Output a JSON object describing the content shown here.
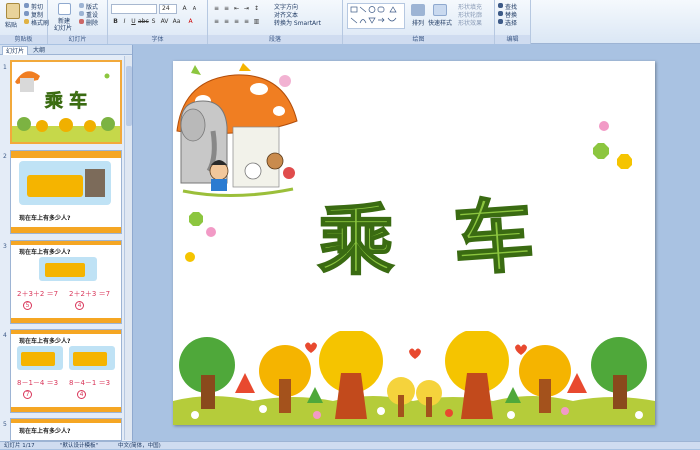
{
  "ribbon": {
    "groups": [
      {
        "label": "剪贴板"
      },
      {
        "label": "幻灯片"
      },
      {
        "label": "字体"
      },
      {
        "label": "段落"
      },
      {
        "label": "绘图"
      },
      {
        "label": "编辑"
      }
    ],
    "clipboard": {
      "paste": "粘贴",
      "cut": "剪切",
      "copy": "复制",
      "format_painter": "格式刷"
    },
    "slides": {
      "new_slide": "新建",
      "new_slide_2": "幻灯片",
      "layout": "版式",
      "reset": "重设",
      "delete": "删除"
    },
    "font": {
      "font_size": "24"
    },
    "paragraph": {
      "text_direction": "文字方向",
      "align_text": "对齐文本",
      "smartart": "转换为 SmartArt"
    },
    "drawing": {
      "arrange": "排列",
      "quick_styles": "快速样式",
      "shape_fill": "形状填充",
      "shape_outline": "形状轮廓",
      "shape_effects": "形状效果"
    },
    "editing": {
      "find": "查找",
      "replace": "替换",
      "select": "选择"
    }
  },
  "panel": {
    "tabs": [
      "幻灯片",
      "大纲"
    ],
    "thumbs": [
      {
        "num": "1",
        "title": "乘 车"
      },
      {
        "num": "2",
        "caption": "现在车上有多少人?"
      },
      {
        "num": "3",
        "caption": "现在车上有多少人?",
        "eq1": "2＋3＋2 ＝7",
        "eq2": "2＋2＋3 ＝7",
        "c1": "5",
        "c2": "4"
      },
      {
        "num": "4",
        "caption": "现在车上有多少人?",
        "eq1": "8－1－4 ＝3",
        "eq2": "8－4－1 ＝3",
        "c1": "7",
        "c2": "4"
      },
      {
        "num": "5",
        "caption": "现在车上有多少人?"
      }
    ]
  },
  "slide": {
    "title_char_1": "乘",
    "title_char_2": "车"
  },
  "status": {
    "slide_info": "幻灯片 1/17",
    "theme": "\"默认设计模板\"",
    "language": "中文(简体，中国)"
  }
}
